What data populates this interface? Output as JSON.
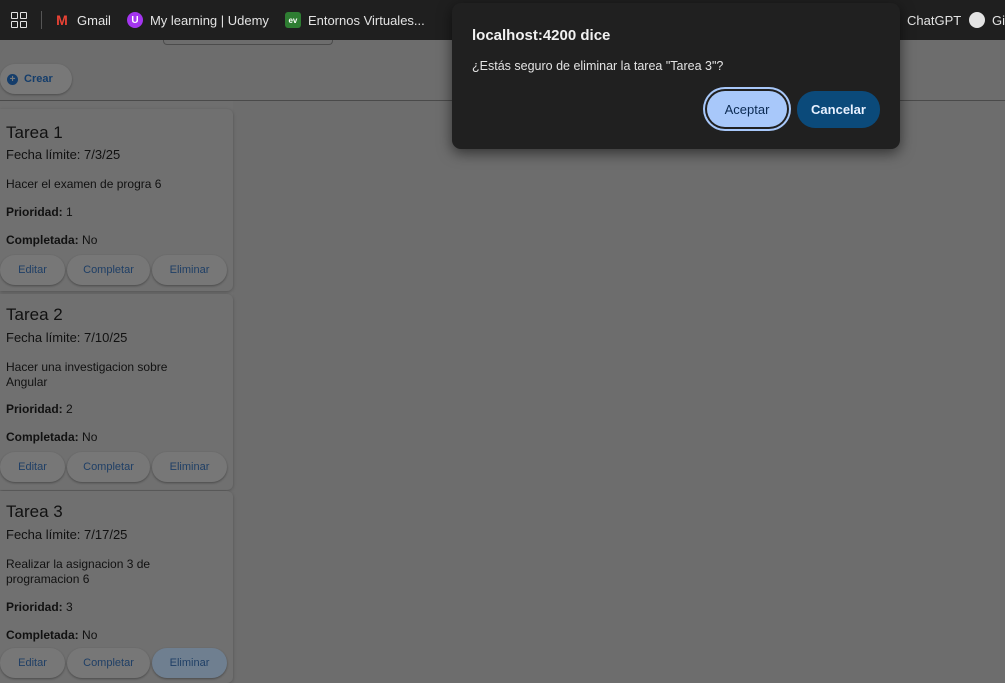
{
  "bookmarks": {
    "items": [
      {
        "label": "Gmail",
        "icon": "gmail-icon"
      },
      {
        "label": "My learning | Udemy",
        "icon": "udemy-icon"
      },
      {
        "label": "Entornos Virtuales...",
        "icon": "entornos-icon"
      },
      {
        "label": "",
        "icon": "bird-icon"
      }
    ],
    "right_items": [
      {
        "label": "ChatGPT",
        "icon": ""
      },
      {
        "label": "Git",
        "icon": "github-icon"
      }
    ]
  },
  "toolbar": {
    "create_label": "Crear"
  },
  "tasks": [
    {
      "title": "Tarea 1",
      "due_label": "Fecha límite: 7/3/25",
      "description": "Hacer el examen de progra 6",
      "priority_label": "Prioridad:",
      "priority_value": "1",
      "completed_label": "Completada:",
      "completed_value": "No",
      "actions": {
        "edit": "Editar",
        "complete": "Completar",
        "delete": "Eliminar"
      }
    },
    {
      "title": "Tarea 2",
      "due_label": "Fecha límite: 7/10/25",
      "description": "Hacer una investigacion sobre Angular",
      "priority_label": "Prioridad:",
      "priority_value": "2",
      "completed_label": "Completada:",
      "completed_value": "No",
      "actions": {
        "edit": "Editar",
        "complete": "Completar",
        "delete": "Eliminar"
      }
    },
    {
      "title": "Tarea 3",
      "due_label": "Fecha límite: 7/17/25",
      "description": "Realizar la asignacion 3 de programacion 6",
      "priority_label": "Prioridad:",
      "priority_value": "3",
      "completed_label": "Completada:",
      "completed_value": "No",
      "actions": {
        "edit": "Editar",
        "complete": "Completar",
        "delete": "Eliminar"
      }
    }
  ],
  "dialog": {
    "title": "localhost:4200 dice",
    "message": "¿Estás seguro de eliminar la tarea \"Tarea 3\"?",
    "accept_label": "Aceptar",
    "cancel_label": "Cancelar"
  },
  "colors": {
    "accent": "#a8c8fa",
    "cancel_button": "#0b4a7a",
    "dialog_bg": "#202020",
    "overlay": "#6f6f6f"
  }
}
